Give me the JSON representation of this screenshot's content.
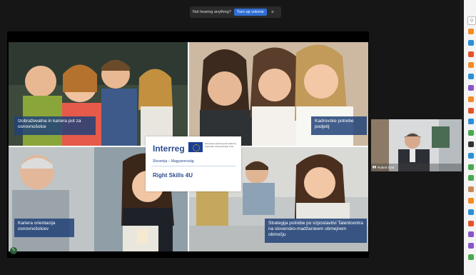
{
  "toast": {
    "message": "Not hearing anything?",
    "button": "Turn up volume",
    "close": "×"
  },
  "slide": {
    "logo": {
      "brand": "Interreg",
      "region": "Slovenija – Magyarország",
      "project": "Right Skills 4U",
      "funding": "Evropska unija Evropski sklad za regionalni razvoj Európai Unió"
    },
    "tiles": [
      {
        "label": "Izobraževalna in kariera pot za osnovnošolce"
      },
      {
        "label": "Kadrovske potrebe podjetij"
      },
      {
        "label": "Kariera orientacija osnovnošolcev"
      },
      {
        "label": "Strategija potrebe po vzpostavitvi Talentcentra na slovensko-madžarskem obmejnem območju"
      }
    ]
  },
  "participant": {
    "name": "Robert Gart"
  },
  "sidebar": {
    "top_icon": "Q",
    "colors": [
      "#f28c28",
      "#2f8fd6",
      "#e0552d",
      "#f28c28",
      "#2f8fd6",
      "#8a55c9",
      "#f28c28",
      "#e0552d",
      "#2f8fd6",
      "#4aa84f",
      "#333333",
      "#2f8fd6",
      "#4aa84f",
      "#4aa84f",
      "#c98a5a",
      "#f28c28",
      "#2f8fd6",
      "#e0552d",
      "#8a55c9",
      "#8a55c9",
      "#4aa84f"
    ]
  }
}
